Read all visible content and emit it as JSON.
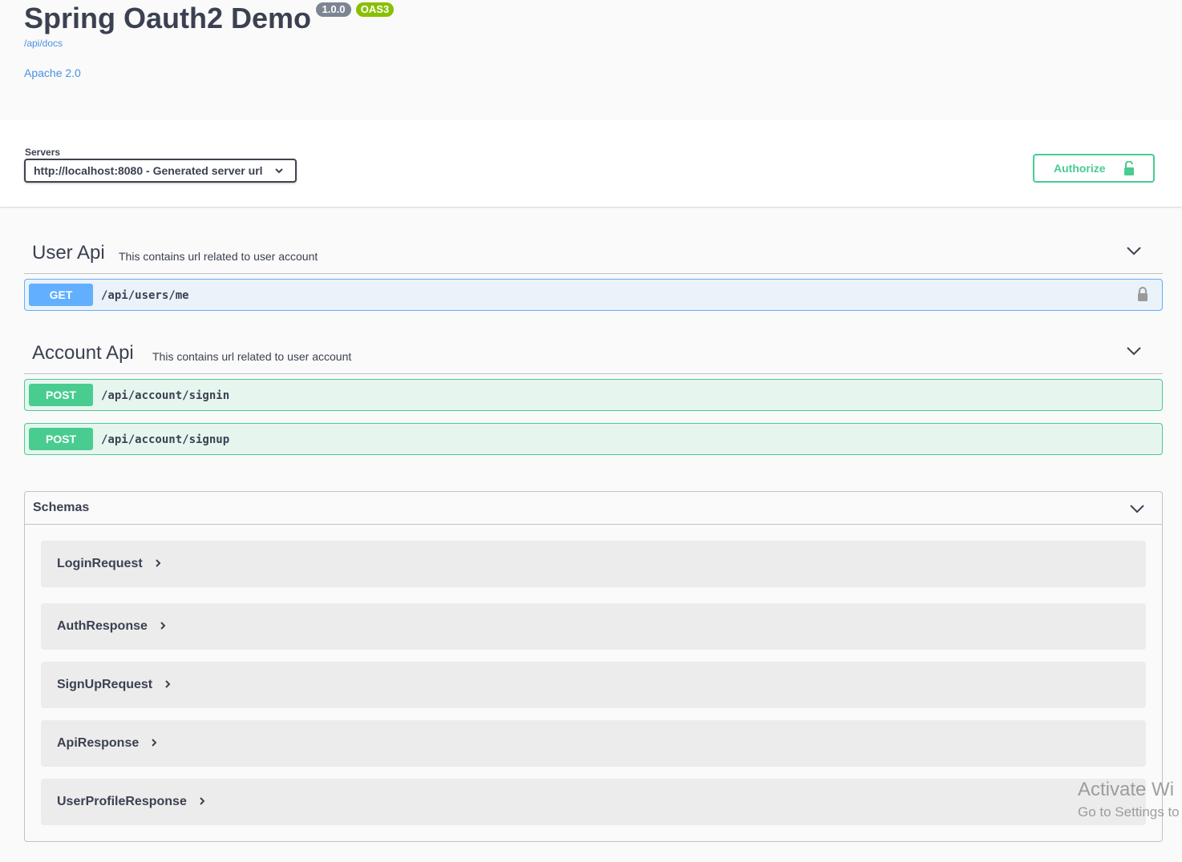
{
  "info": {
    "title": "Spring Oauth2 Demo",
    "version": "1.0.0",
    "spec_badge": "OAS3",
    "docs_link": "/api/docs",
    "license": "Apache 2.0"
  },
  "servers": {
    "label": "Servers",
    "selected": "http://localhost:8080 - Generated server url"
  },
  "authorize": {
    "label": "Authorize",
    "icon": "unlock-icon"
  },
  "tags": [
    {
      "name": "User Api",
      "description": "This contains url related to user account",
      "operations": [
        {
          "method": "GET",
          "path": "/api/users/me",
          "locked": true
        }
      ]
    },
    {
      "name": "Account Api",
      "description": "This contains url related to user account",
      "operations": [
        {
          "method": "POST",
          "path": "/api/account/signin"
        },
        {
          "method": "POST",
          "path": "/api/account/signup"
        }
      ]
    }
  ],
  "schemas": {
    "title": "Schemas",
    "models": [
      "LoginRequest",
      "AuthResponse",
      "SignUpRequest",
      "ApiResponse",
      "UserProfileResponse"
    ]
  },
  "watermark": {
    "line1": "Activate Wi",
    "line2": "Go to Settings to"
  },
  "colors": {
    "get": "#61affe",
    "post": "#49cc90",
    "link": "#4990e2",
    "text": "#3b4151"
  }
}
